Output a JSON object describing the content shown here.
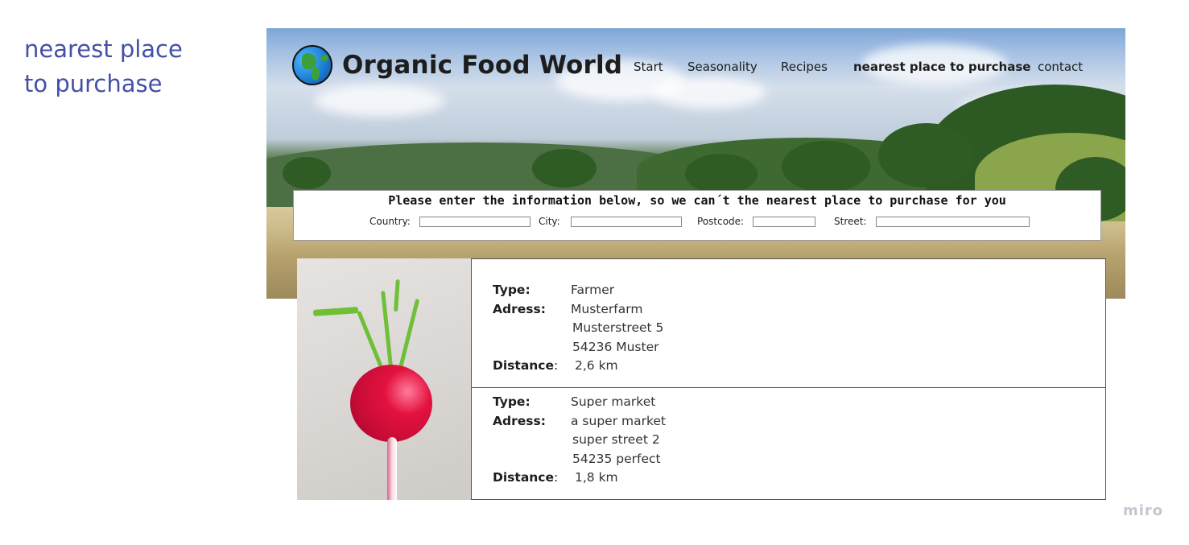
{
  "frame": {
    "title_line1": "nearest place",
    "title_line2": "to purchase"
  },
  "header": {
    "site_name": "Organic Food World",
    "logo_icon": "globe-icon",
    "nav": [
      {
        "label": "Start",
        "active": false
      },
      {
        "label": "Seasonality",
        "active": false
      },
      {
        "label": "Recipes",
        "active": false
      },
      {
        "label": "nearest place to purchase",
        "active": true
      },
      {
        "label": "contact",
        "active": false
      }
    ]
  },
  "search": {
    "heading": "Please enter the information below, so we can´t the nearest place to purchase for you",
    "fields": [
      {
        "label": "Country:",
        "value": ""
      },
      {
        "label": "City:",
        "value": ""
      },
      {
        "label": "Postcode:",
        "value": ""
      },
      {
        "label": "Street:",
        "value": ""
      }
    ]
  },
  "results": {
    "labels": {
      "type": "Type:",
      "adress": "Adress:",
      "distance": "Distance",
      "distance_colon": ":"
    },
    "items": [
      {
        "type": "Farmer",
        "adress_lines": [
          "Musterfarm",
          "Musterstreet 5",
          "54236 Muster"
        ],
        "distance": "2,6 km"
      },
      {
        "type": "Super market",
        "adress_lines": [
          "a super market",
          "super street 2",
          "54235 perfect"
        ],
        "distance": "1,8 km"
      }
    ]
  },
  "watermark": "miro"
}
